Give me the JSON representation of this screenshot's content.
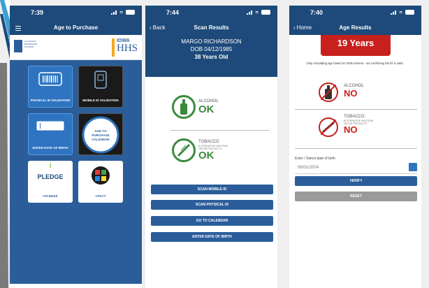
{
  "phone1": {
    "time": "7:39",
    "title": "Age to Purchase",
    "logos": {
      "abc_text": "ALCOHOLIC BEVERAGES DIVISION",
      "iowa": "IOWA",
      "hhs": "HHS"
    },
    "tiles": [
      {
        "label": "PHYSICAL ID VALIDATION"
      },
      {
        "label": "MOBILE ID VALIDATION"
      },
      {
        "label": "ENTER DATE OF BIRTH"
      },
      {
        "label": "AGE TO PURCHASE CALENDAR"
      },
      {
        "label": "I-PLEDGE",
        "graphic_text": "PLEDGE"
      },
      {
        "label": "I-PACT"
      }
    ]
  },
  "phone2": {
    "time": "7:44",
    "back_label": "Back",
    "title": "Scan Results",
    "name": "MARGO RICHARDSON",
    "dob": "DOB 04/12/1985",
    "age": "38 Years Old",
    "alcohol": {
      "label": "ALCOHOL",
      "status": "OK"
    },
    "tobacco": {
      "label": "TOBACCO",
      "sub": "ALTERNATIVE NICOTINE VAPOR PRODUCTS",
      "status": "OK"
    },
    "buttons": [
      "SCAN MOBILE ID",
      "SCAN PHYSICAL ID",
      "GO TO CALENDAR",
      "ENTER DATE OF BIRTH"
    ]
  },
  "phone3": {
    "time": "7:40",
    "back_label": "Home",
    "title": "Age Results",
    "age_banner": "19 Years",
    "disclaimer": "Only calculating age based on DOB entered - not confirming the ID is valid.",
    "alcohol": {
      "label": "ALCOHOL",
      "status": "NO"
    },
    "tobacco": {
      "label": "TOBACCO",
      "sub": "ALTERNATIVE NICOTINE VAPOR PRODUCTS",
      "status": "NO"
    },
    "date_label": "Enter / Select date of birth",
    "date_value": "06/01/2004",
    "verify_label": "VERIFY",
    "reset_label": "RESET"
  },
  "colors": {
    "navy": "#1d4a7a",
    "blue": "#2b5d9b",
    "ok_green": "#3b8a3c",
    "no_red": "#c8201d"
  }
}
